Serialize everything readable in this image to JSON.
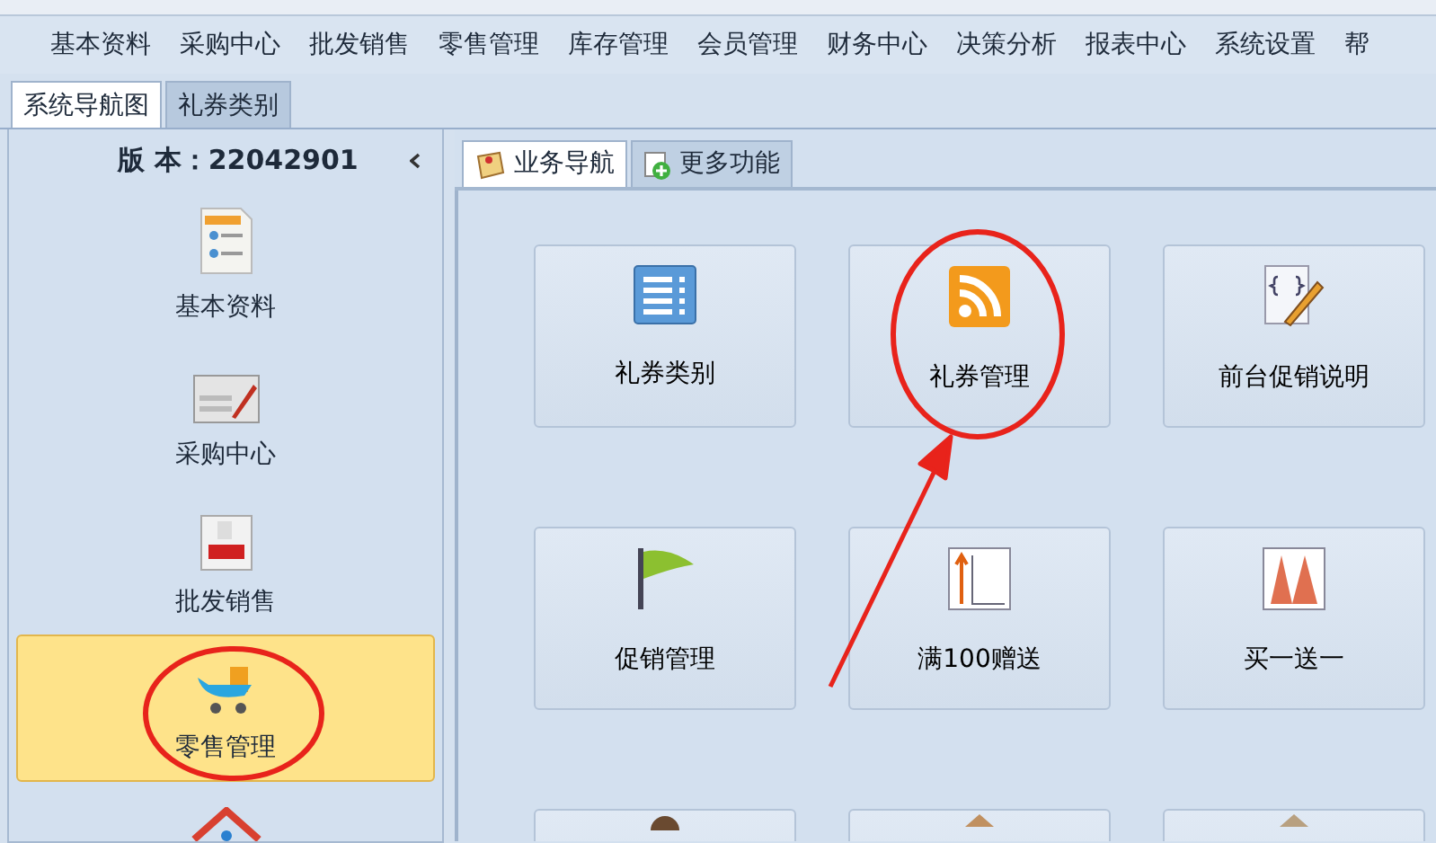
{
  "menu": [
    {
      "label": "基本资料"
    },
    {
      "label": "采购中心"
    },
    {
      "label": "批发销售"
    },
    {
      "label": "零售管理"
    },
    {
      "label": "库存管理"
    },
    {
      "label": "会员管理"
    },
    {
      "label": "财务中心"
    },
    {
      "label": "决策分析"
    },
    {
      "label": "报表中心"
    },
    {
      "label": "系统设置"
    },
    {
      "label": "帮"
    }
  ],
  "tabs": [
    {
      "label": "系统导航图",
      "selected": true
    },
    {
      "label": "礼券类别",
      "selected": false
    }
  ],
  "sidebar": {
    "version": "版 本：22042901",
    "items": [
      {
        "kind": "full",
        "label": "基本资料",
        "selected": false
      },
      {
        "kind": "full",
        "label": "采购中心",
        "selected": false
      },
      {
        "kind": "full",
        "label": "批发销售",
        "selected": false
      },
      {
        "kind": "full",
        "label": "零售管理",
        "selected": true
      },
      {
        "kind": "partial",
        "selected": false
      }
    ]
  },
  "inner_tabs": [
    {
      "label": "业务导航",
      "selected": true
    },
    {
      "label": "更多功能",
      "selected": false
    }
  ],
  "tiles": [
    {
      "kind": "full",
      "label": "礼券类别"
    },
    {
      "kind": "full",
      "label": "礼券管理"
    },
    {
      "kind": "full",
      "label": "前台促销说明"
    },
    {
      "kind": "full",
      "label": "促销管理"
    },
    {
      "kind": "full",
      "label": "满100赠送"
    },
    {
      "kind": "full",
      "label": "买一送一"
    },
    {
      "kind": "partial"
    },
    {
      "kind": "partial"
    },
    {
      "kind": "partial"
    }
  ]
}
